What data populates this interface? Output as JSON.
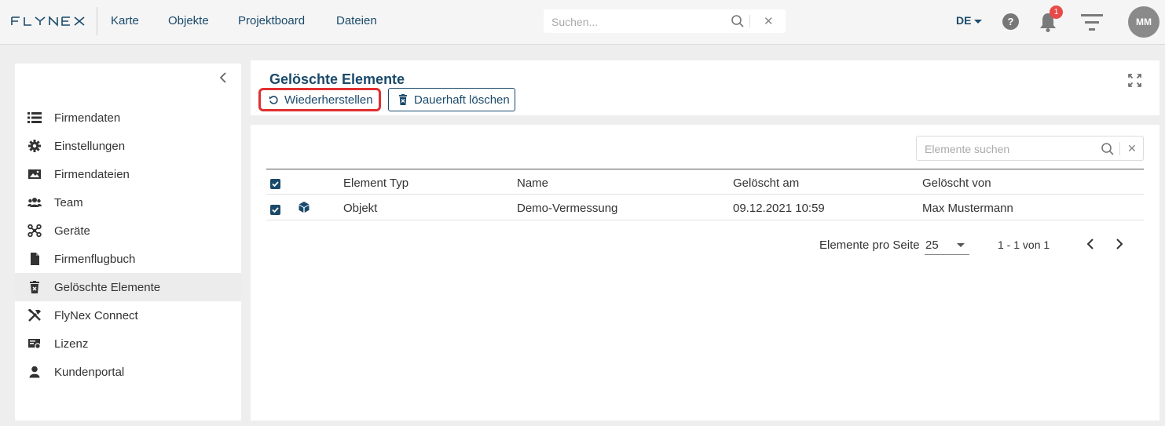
{
  "header": {
    "logo_text": "FLYNEX",
    "nav": [
      "Karte",
      "Objekte",
      "Projektboard",
      "Dateien"
    ],
    "search_placeholder": "Suchen...",
    "language": "DE",
    "notification_count": "1",
    "avatar_initials": "MM"
  },
  "sidebar": {
    "items": [
      {
        "label": "Firmendaten",
        "icon": "list-icon"
      },
      {
        "label": "Einstellungen",
        "icon": "gear-icon"
      },
      {
        "label": "Firmendateien",
        "icon": "image-folder-icon"
      },
      {
        "label": "Team",
        "icon": "users-icon"
      },
      {
        "label": "Geräte",
        "icon": "drone-icon"
      },
      {
        "label": "Firmenflugbuch",
        "icon": "book-icon"
      },
      {
        "label": "Gelöschte Elemente",
        "icon": "trash-icon",
        "active": true
      },
      {
        "label": "FlyNex Connect",
        "icon": "tools-icon"
      },
      {
        "label": "Lizenz",
        "icon": "license-icon"
      },
      {
        "label": "Kundenportal",
        "icon": "person-icon"
      }
    ]
  },
  "main": {
    "title": "Gelöschte Elemente",
    "restore_label": "Wiederherstellen",
    "delete_label": "Dauerhaft löschen",
    "search_placeholder": "Elemente suchen",
    "columns": [
      "Element Typ",
      "Name",
      "Gelöscht am",
      "Gelöscht von"
    ],
    "rows": [
      {
        "type": "Objekt",
        "name": "Demo-Vermessung",
        "deleted_at": "09.12.2021 10:59",
        "deleted_by": "Max Mustermann",
        "checked": true,
        "icon": "cube-icon"
      }
    ],
    "pager": {
      "label": "Elemente pro Seite",
      "page_size": "25",
      "range": "1 - 1 von 1"
    }
  },
  "colors": {
    "accent": "#1a4a6b",
    "highlight": "#e03030",
    "badge": "#e84a4a"
  }
}
